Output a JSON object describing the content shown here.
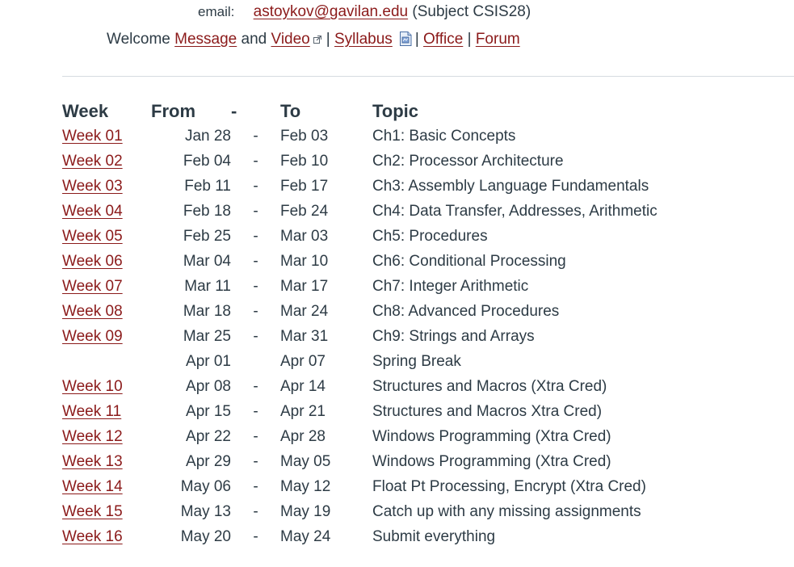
{
  "header": {
    "email_label": "email:",
    "email_link": "astoykov@gavilan.edu",
    "email_subject": "(Subject CSIS28)",
    "welcome_text": "Welcome",
    "message_link": "Message",
    "and_text": "and",
    "video_link": "Video",
    "separator": "|",
    "syllabus_link": "Syllabus",
    "office_link": "Office",
    "forum_link": "Forum"
  },
  "schedule": {
    "columns": [
      "Week",
      "From",
      "-",
      "To",
      "Topic"
    ],
    "rows": [
      {
        "week": "Week 01",
        "from": "Jan 28",
        "dash": "-",
        "to": "Feb 03",
        "topic": "Ch1: Basic Concepts"
      },
      {
        "week": "Week 02",
        "from": "Feb 04",
        "dash": "-",
        "to": "Feb 10",
        "topic": "Ch2: Processor Architecture"
      },
      {
        "week": "Week 03",
        "from": "Feb 11",
        "dash": "-",
        "to": "Feb 17",
        "topic": "Ch3: Assembly Language Fundamentals"
      },
      {
        "week": "Week 04",
        "from": "Feb 18",
        "dash": "-",
        "to": "Feb 24",
        "topic": "Ch4: Data Transfer, Addresses, Arithmetic"
      },
      {
        "week": "Week 05",
        "from": "Feb 25",
        "dash": "-",
        "to": "Mar 03",
        "topic": "Ch5: Procedures"
      },
      {
        "week": "Week 06",
        "from": "Mar 04",
        "dash": "-",
        "to": "Mar 10",
        "topic": "Ch6: Conditional Processing"
      },
      {
        "week": "Week 07",
        "from": "Mar 11",
        "dash": "-",
        "to": "Mar 17",
        "topic": "Ch7: Integer Arithmetic"
      },
      {
        "week": "Week 08",
        "from": "Mar 18",
        "dash": "-",
        "to": "Mar 24",
        "topic": "Ch8: Advanced Procedures"
      },
      {
        "week": "Week 09",
        "from": "Mar 25",
        "dash": "-",
        "to": "Mar 31",
        "topic": "Ch9: Strings and Arrays"
      },
      {
        "week": "",
        "from": "Apr 01",
        "dash": "",
        "to": "Apr 07",
        "topic": "Spring Break"
      },
      {
        "week": "Week 10",
        "from": "Apr 08",
        "dash": "-",
        "to": "Apr 14",
        "topic": "Structures and Macros (Xtra Cred)"
      },
      {
        "week": "Week 11",
        "from": "Apr 15",
        "dash": "-",
        "to": "Apr 21",
        "topic": "Structures and Macros Xtra Cred)"
      },
      {
        "week": "Week 12",
        "from": "Apr 22",
        "dash": "-",
        "to": "Apr 28",
        "topic": "Windows Programming (Xtra Cred)"
      },
      {
        "week": "Week 13",
        "from": "Apr 29",
        "dash": "-",
        "to": "May 05",
        "topic": "Windows Programming (Xtra Cred)"
      },
      {
        "week": "Week 14",
        "from": "May 06",
        "dash": "-",
        "to": "May 12",
        "topic": "Float Pt Processing, Encrypt (Xtra Cred)"
      },
      {
        "week": "Week 15",
        "from": "May 13",
        "dash": "-",
        "to": "May 19",
        "topic": "Catch up with any missing assignments"
      },
      {
        "week": "Week 16",
        "from": "May 20",
        "dash": "-",
        "to": "May 24",
        "topic": "Submit everything"
      }
    ]
  },
  "colors": {
    "link": "#8b1a1a",
    "text": "#2d3b45",
    "divider": "#d6dbe0"
  },
  "icons": {
    "video_link_icon": "external-link-icon",
    "syllabus_icon": "document-icon"
  }
}
